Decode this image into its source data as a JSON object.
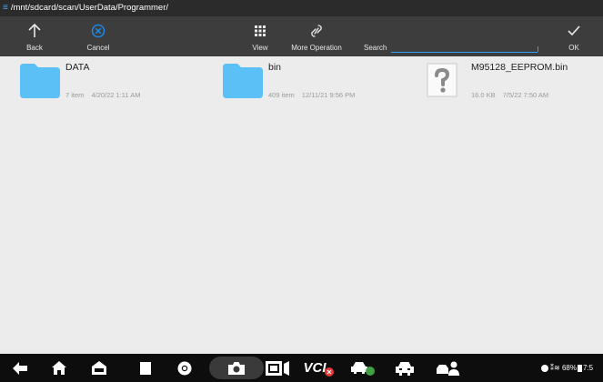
{
  "path": "/mnt/sdcard/scan/UserData/Programmer/",
  "toolbar": {
    "back_label": "Back",
    "cancel_label": "Cancel",
    "view_label": "View",
    "more_label": "More Operation",
    "search_label": "Search",
    "search_value": "",
    "ok_label": "OK"
  },
  "files": [
    {
      "name": "DATA",
      "type": "folder",
      "items": "7 item",
      "date": "4/20/22 1:11 AM"
    },
    {
      "name": "bin",
      "type": "folder",
      "items": "409 item",
      "date": "12/11/21 9:56 PM"
    },
    {
      "name": "M95128_EEPROM.bin",
      "type": "unknown",
      "size": "16.0 KB",
      "date": "7/5/22 7:50 AM"
    }
  ],
  "navbar": {
    "vci_label": "VCI",
    "status_text": "68%",
    "time_partial": "7:5"
  },
  "colors": {
    "accent": "#2f9ff2",
    "folder": "#5bc0f5",
    "toolbar_bg": "#3d3d3d",
    "path_bg": "#2b2b2b",
    "cancel_icon": "#1e88e5",
    "vci_badge": "#e53935",
    "green_badge": "#43a047"
  },
  "icons": {
    "back": "arrow-up-icon",
    "cancel": "circle-x-icon",
    "view": "grid-icon",
    "more": "link-icon",
    "ok": "checkmark-icon"
  }
}
